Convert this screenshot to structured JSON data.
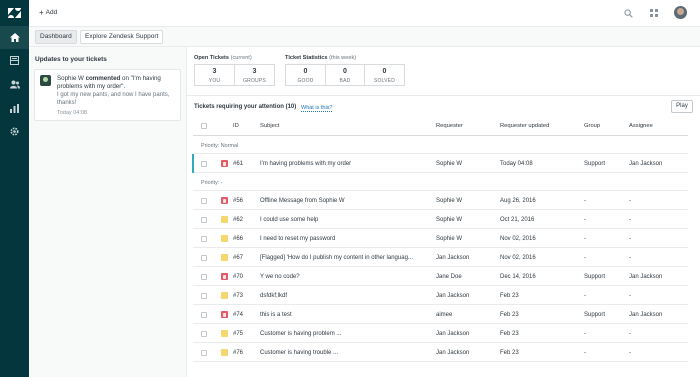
{
  "colors": {
    "nav_bg": "#03363d",
    "nav_active": "#17494d",
    "accent": "#30aabc",
    "link": "#1f73b7",
    "urgent": "#e35b66",
    "open": "#f5d770"
  },
  "nav": {
    "icons": [
      "zendesk-logo-icon",
      "home-icon",
      "views-icon",
      "customers-icon",
      "reporting-icon",
      "admin-gear-icon"
    ]
  },
  "topbar": {
    "add_label": "Add"
  },
  "tabs": [
    {
      "label": "Dashboard"
    },
    {
      "label": "Explore Zendesk Support"
    }
  ],
  "updates": {
    "title": "Updates to your tickets",
    "item": {
      "actor": "Sophie W",
      "verb": "commented",
      "rest": "on \"I'm having problems with my order\".",
      "body": "I got my new pants, and now I have pants, thanks!",
      "time": "Today 04:08"
    }
  },
  "open_tickets": {
    "title": "Open Tickets",
    "qualifier": "(current)",
    "boxes": [
      {
        "value": "3",
        "label": "YOU"
      },
      {
        "value": "3",
        "label": "GROUPS"
      }
    ]
  },
  "ticket_statistics": {
    "title": "Ticket Statistics",
    "qualifier": "(this week)",
    "boxes": [
      {
        "value": "0",
        "label": "GOOD"
      },
      {
        "value": "0",
        "label": "BAD"
      },
      {
        "value": "0",
        "label": "SOLVED"
      }
    ]
  },
  "tickets": {
    "title": "Tickets requiring your attention",
    "count": "(10)",
    "what_is_this": "What is this?",
    "play_label": "Play",
    "columns": [
      "ID",
      "Subject",
      "Requester",
      "Requester updated",
      "Group",
      "Assignee"
    ],
    "groups": [
      {
        "label": "Priority: Normal",
        "rows": [
          {
            "status": "urgent",
            "id": "#61",
            "subject": "I'm having problems with my order",
            "requester": "Sophie W",
            "updated": "Today 04:08",
            "group": "Support",
            "assignee": "Jan Jackson"
          }
        ]
      },
      {
        "label": "Priority: -",
        "rows": [
          {
            "status": "urgent",
            "id": "#56",
            "subject": "Offline Message from Sophie W",
            "requester": "Sophie W",
            "updated": "Aug 26, 2016",
            "group": "-",
            "assignee": "-"
          },
          {
            "status": "normal",
            "id": "#62",
            "subject": "I could use some help",
            "requester": "Sophie W",
            "updated": "Oct 21, 2016",
            "group": "-",
            "assignee": "-"
          },
          {
            "status": "normal",
            "id": "#66",
            "subject": "I need to reset my password",
            "requester": "Sophie W",
            "updated": "Nov 02, 2016",
            "group": "-",
            "assignee": "-"
          },
          {
            "status": "normal",
            "id": "#67",
            "subject": "[Flagged] 'How do I publish my content in other languag...",
            "requester": "Jan Jackson",
            "updated": "Nov 02, 2016",
            "group": "-",
            "assignee": "-"
          },
          {
            "status": "urgent",
            "id": "#70",
            "subject": "Y we no code?",
            "requester": "Jane Doe",
            "updated": "Dec 14, 2016",
            "group": "Support",
            "assignee": "Jan Jackson"
          },
          {
            "status": "normal",
            "id": "#73",
            "subject": "dsfdkf;lkdf",
            "requester": "Jan Jackson",
            "updated": "Feb 23",
            "group": "-",
            "assignee": "-"
          },
          {
            "status": "urgent",
            "id": "#74",
            "subject": "this is a test",
            "requester": "aimee",
            "updated": "Feb 23",
            "group": "Support",
            "assignee": "Jan Jackson"
          },
          {
            "status": "normal",
            "id": "#75",
            "subject": "Customer is having problem ...",
            "requester": "Jan Jackson",
            "updated": "Feb 23",
            "group": "-",
            "assignee": "-"
          },
          {
            "status": "normal",
            "id": "#76",
            "subject": "Customer is having trouble ...",
            "requester": "Jan Jackson",
            "updated": "Feb 23",
            "group": "-",
            "assignee": "-"
          }
        ]
      }
    ]
  }
}
